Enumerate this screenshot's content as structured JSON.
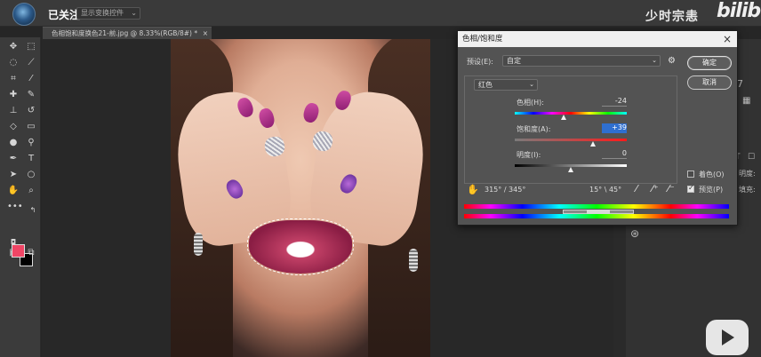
{
  "top": {
    "follow_label": "已关注",
    "preset_text": "显示变换控件",
    "watermark": "少时宗恚",
    "logo": "bilib"
  },
  "document_tab": {
    "title": "色相饱和度换色21-前.jpg @ 8.33%(RGB/8#) *",
    "close": "×"
  },
  "dialog": {
    "title": "色相/饱和度",
    "close": "×",
    "preset_label": "预设(E):",
    "preset_value": "自定",
    "ok": "确定",
    "cancel": "取消",
    "channel_value": "红色",
    "hue_label": "色相(H):",
    "hue_value": "-24",
    "saturation_label": "饱和度(A):",
    "saturation_value": "+39",
    "lightness_label": "明度(I):",
    "lightness_value": "0",
    "colorize_label": "着色(O)",
    "preview_label": "预览(P)",
    "range_left": "315° / 345°",
    "range_right": "15° \\ 45°",
    "colorize_checked": false,
    "preview_checked": true,
    "sliders": {
      "hue_min": -180,
      "hue_max": 180,
      "sat_min": -100,
      "sat_max": 100,
      "light_min": -100,
      "light_max": 100
    }
  },
  "right_panel": {
    "digit": "7",
    "t_label": "T",
    "label_a": "明度:",
    "label_b": "填充:"
  },
  "colors": {
    "foreground": "#f04565",
    "background": "#000000"
  },
  "icons": [
    "move-icon",
    "marquee-icon",
    "lasso-icon",
    "quick-select-icon",
    "crop-icon",
    "eyedropper-icon",
    "healing-icon",
    "brush-icon",
    "stamp-icon",
    "history-brush-icon",
    "eraser-icon",
    "gradient-icon",
    "blur-icon",
    "dodge-icon",
    "pen-icon",
    "type-icon",
    "path-select-icon",
    "shape-icon",
    "hand-icon",
    "zoom-icon",
    "more-tools-icon",
    "swap-colors-icon",
    "quick-mask-icon",
    "screen-mode-icon",
    "hand-adjust-icon",
    "eyedropper-plus-icon",
    "eyedropper-minus-icon",
    "settings-icon"
  ]
}
